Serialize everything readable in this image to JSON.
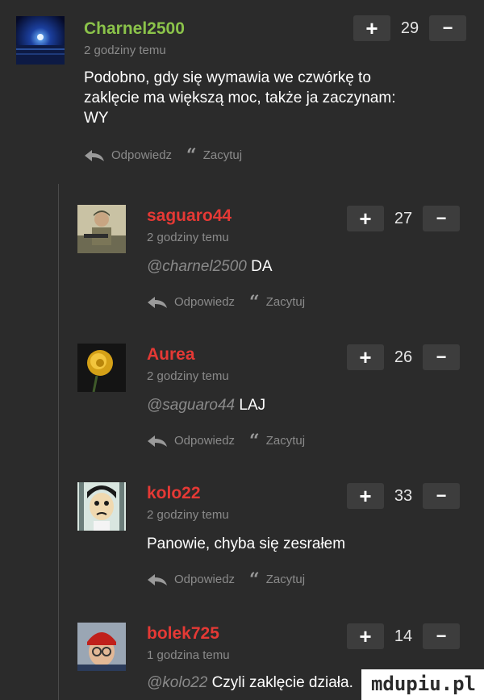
{
  "actions": {
    "reply_label": "Odpowiedz",
    "quote_label": "Zacytuj"
  },
  "comments": [
    {
      "username": "Charnel2500",
      "username_color": "#8bc34a",
      "time": "2 godziny temu",
      "votes": "29",
      "text": "Podobno, gdy się wymawia we czwórkę to zaklęcie ma większą moc, także ja zaczynam: WY",
      "avatar_icon": "night-sky-icon"
    },
    {
      "username": "saguaro44",
      "username_color": "#e53935",
      "time": "2 godziny temu",
      "votes": "27",
      "mention": "@charnel2500",
      "text": "DA",
      "avatar_icon": "soldier-icon"
    },
    {
      "username": "Aurea",
      "username_color": "#e53935",
      "time": "2 godziny temu",
      "votes": "26",
      "mention": "@saguaro44",
      "text": "LAJ",
      "avatar_icon": "rose-icon"
    },
    {
      "username": "kolo22",
      "username_color": "#e53935",
      "time": "2 godziny temu",
      "votes": "33",
      "text": "Panowie, chyba się zesrałem",
      "avatar_icon": "cartoon-face-icon"
    },
    {
      "username": "bolek725",
      "username_color": "#e53935",
      "time": "1 godzina temu",
      "votes": "14",
      "mention": "@kolo22",
      "text": "Czyli zaklęcie działa.",
      "avatar_icon": "red-hat-face-icon"
    }
  ],
  "vote": {
    "plus": "+",
    "minus": "−"
  },
  "watermark": "mdupiu.pl"
}
